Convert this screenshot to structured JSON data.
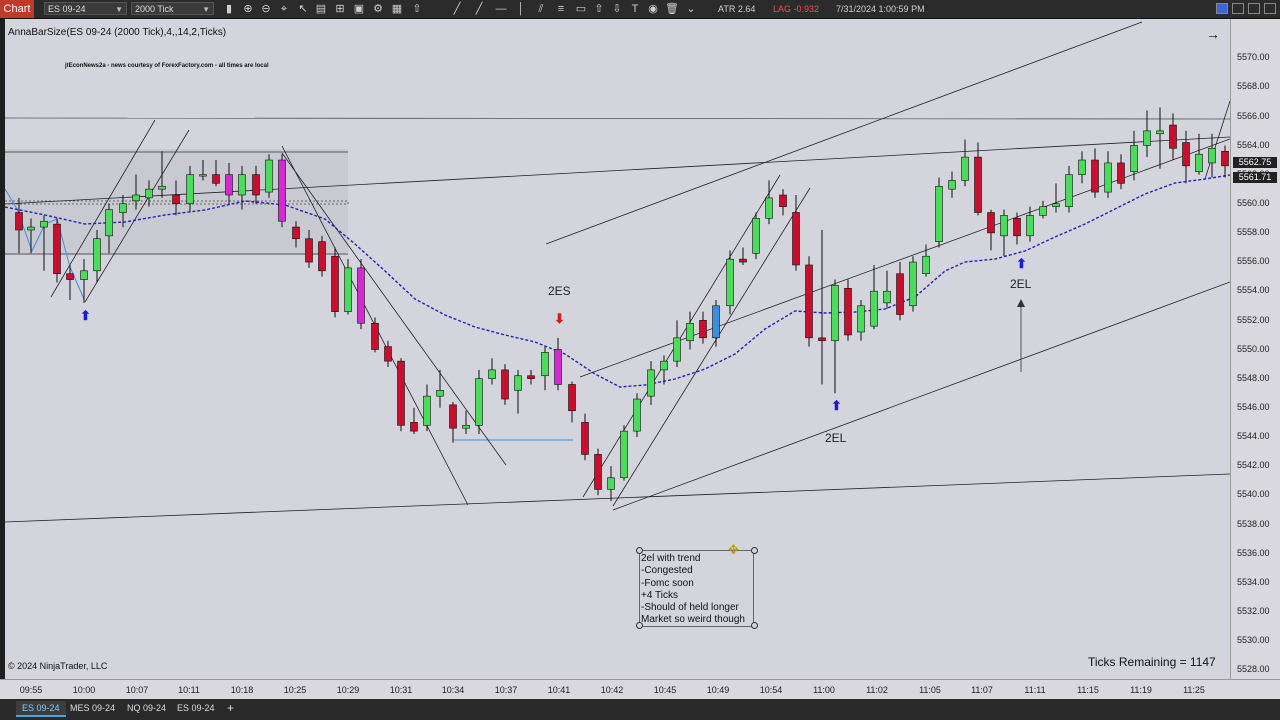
{
  "toolbar": {
    "chart_label": "Chart",
    "instrument": "ES 09-24",
    "interval": "2000 Tick",
    "atr": "ATR 2.64",
    "lag": "LAG -0.932",
    "datetime": "7/31/2024 1:00:59 PM",
    "colors": {
      "chart_tab": "#c0392b",
      "atr": "#d0d0d0",
      "lag": "#ff4a4a"
    }
  },
  "chart": {
    "indicator_label": "AnnaBarSize(ES 09-24 (2000 Tick),4,,14,2,Ticks)",
    "news_label": "jtEconNews2a - news courtesy of ForexFactory.com - all times are local",
    "copyright": "© 2024 NinjaTrader, LLC",
    "ticks_remaining": "Ticks Remaining = 1147",
    "annotations": {
      "es_left": "2ES",
      "el_mid": "2EL",
      "el_right": "2EL"
    },
    "note_lines": [
      "2el with trend",
      "-Congested",
      "-Fomc soon",
      "+4 Ticks",
      "-Should of held longer",
      "Market so weird though"
    ],
    "price_ticks": [
      "5570.00",
      "5568.00",
      "5566.00",
      "5564.00",
      "5562.00",
      "5560.00",
      "5558.00",
      "5556.00",
      "5554.00",
      "5552.00",
      "5550.00",
      "5548.00",
      "5546.00",
      "5544.00",
      "5542.00",
      "5540.00",
      "5538.00",
      "5536.00",
      "5534.00",
      "5532.00",
      "5530.00",
      "5528.00"
    ],
    "last_price": "5562.75",
    "ma_price": "5561.71",
    "time_ticks": [
      "09:55",
      "10:00",
      "10:07",
      "10:11",
      "10:18",
      "10:25",
      "10:29",
      "10:31",
      "10:34",
      "10:37",
      "10:41",
      "10:42",
      "10:45",
      "10:49",
      "10:54",
      "11:00",
      "11:02",
      "11:05",
      "11:07",
      "11:11",
      "11:15",
      "11:19",
      "11:25"
    ],
    "colors": {
      "up_bar": "#4cdc5c",
      "down_bar": "#c8102e",
      "signal_bar": "#d42ad4",
      "blue_bar": "#3b8fe0",
      "ema": "#2222bb",
      "price_label": "#222222"
    }
  },
  "tabs": [
    "ES 09-24",
    "MES 09-24",
    "NQ 09-24",
    "ES 09-24",
    "+"
  ]
}
